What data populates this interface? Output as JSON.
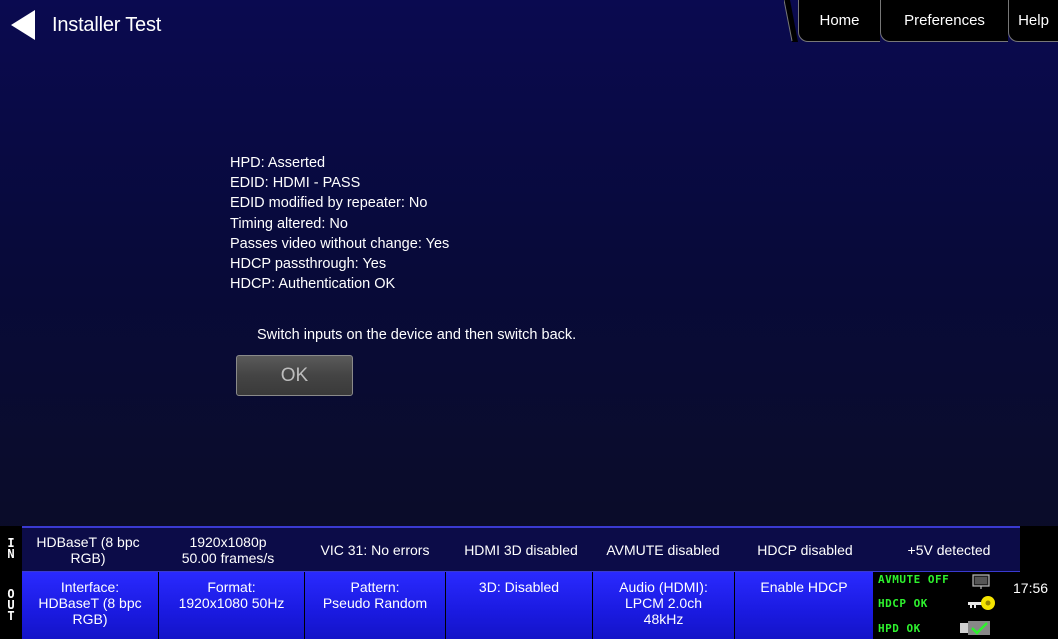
{
  "header": {
    "title": "Installer Test",
    "tabs": {
      "home": "Home",
      "preferences": "Preferences",
      "help": "Help"
    }
  },
  "status_lines": [
    "HPD: Asserted",
    "EDID: HDMI - PASS",
    "EDID modified by repeater: No",
    "Timing altered: No",
    "Passes video without change: Yes",
    "HDCP passthrough: Yes",
    "HDCP: Authentication OK"
  ],
  "instruction": "Switch inputs on the device and then switch back.",
  "ok_label": "OK",
  "in_row": {
    "label_letters": [
      "I",
      "N"
    ],
    "cells": [
      {
        "line1": "HDBaseT (8 bpc",
        "line2": "RGB)"
      },
      {
        "line1": "1920x1080p",
        "line2": "50.00 frames/s"
      },
      {
        "line1": "VIC 31: No errors",
        "line2": ""
      },
      {
        "line1": "HDMI 3D disabled",
        "line2": ""
      },
      {
        "line1": "AVMUTE disabled",
        "line2": ""
      },
      {
        "line1": "HDCP disabled",
        "line2": ""
      },
      {
        "line1": "+5V detected",
        "line2": ""
      }
    ]
  },
  "out_row": {
    "label_letters": [
      "O",
      "U",
      "T"
    ],
    "cells": [
      {
        "line1": "Interface:",
        "line2": "HDBaseT (8 bpc",
        "line3": "RGB)"
      },
      {
        "line1": "Format:",
        "line2": "1920x1080 50Hz",
        "line3": ""
      },
      {
        "line1": "Pattern:",
        "line2": "Pseudo Random",
        "line3": ""
      },
      {
        "line1": "3D: Disabled",
        "line2": "",
        "line3": ""
      },
      {
        "line1": "Audio (HDMI):",
        "line2": "LPCM 2.0ch",
        "line3": "48kHz"
      },
      {
        "line1": "Enable HDCP",
        "line2": "",
        "line3": ""
      }
    ]
  },
  "indicators": {
    "avmute": "AVMUTE OFF",
    "hdcp": "HDCP OK",
    "hpd": "HPD OK"
  },
  "clock": "17:56",
  "colors": {
    "indicator_green": "#2ef22e",
    "out_button_blue": "#1a1ae0",
    "background_navy": "#080a3a"
  }
}
